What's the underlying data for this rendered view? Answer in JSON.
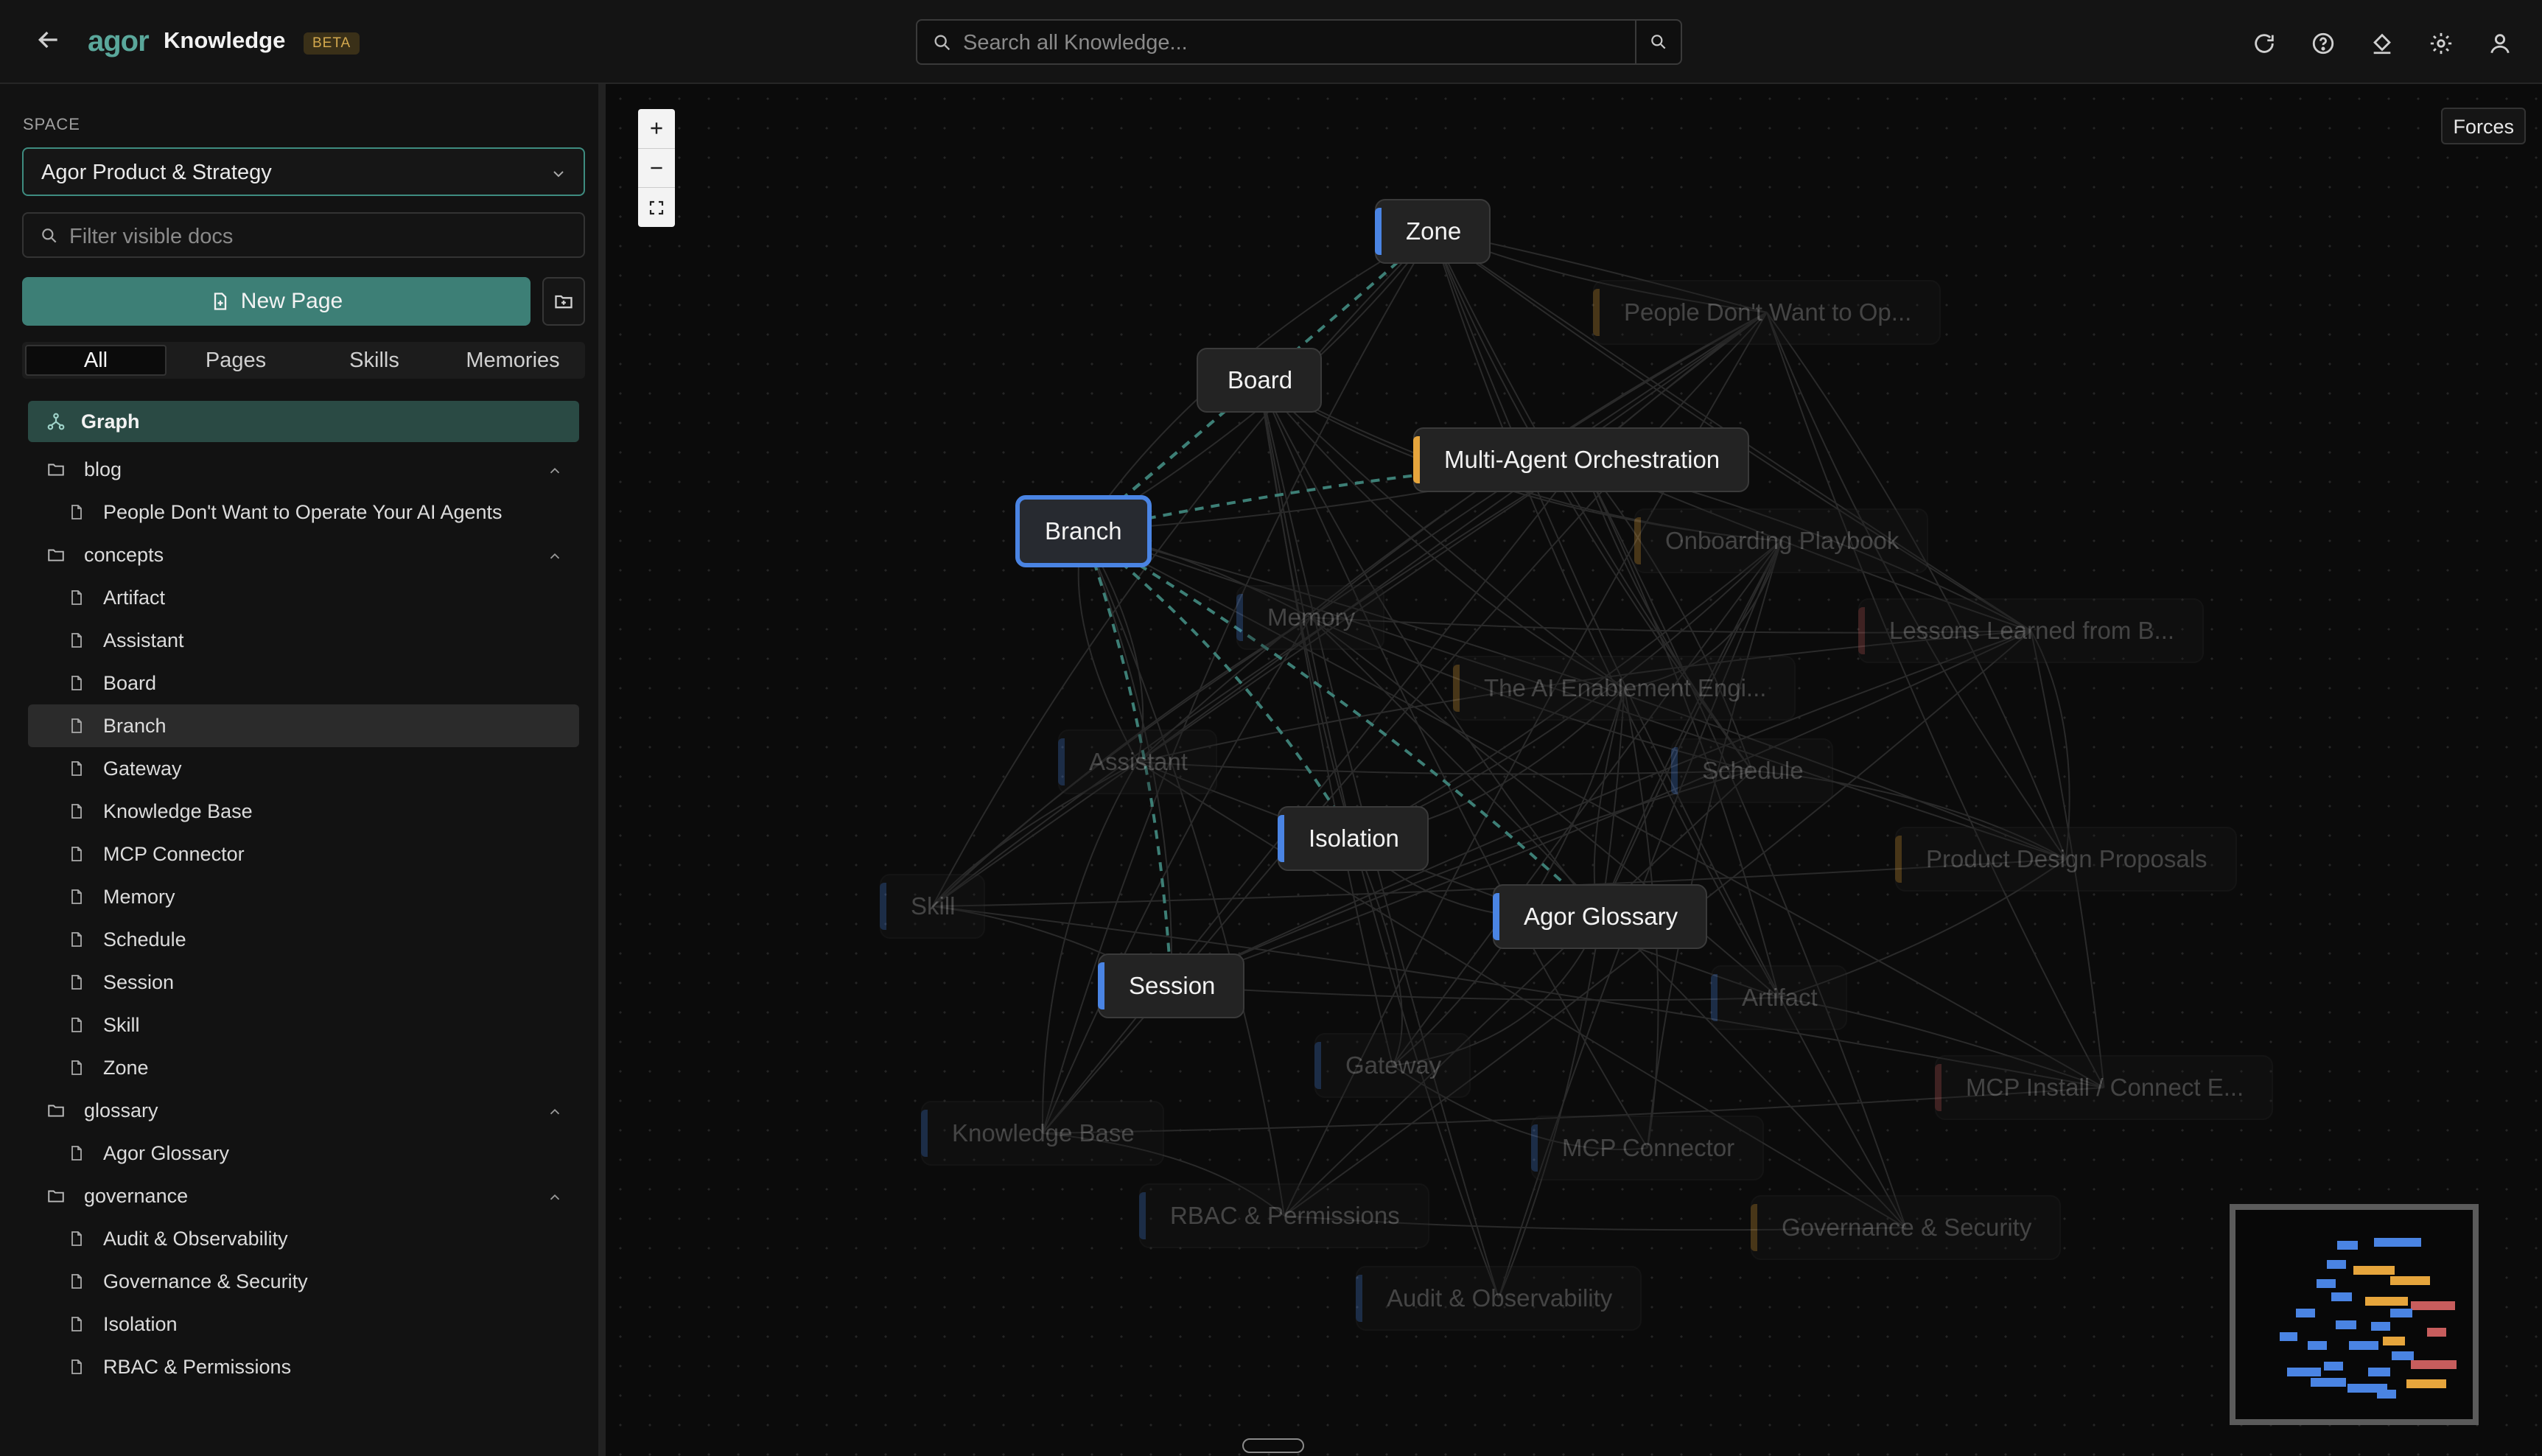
{
  "header": {
    "brand": "agor",
    "title": "Knowledge",
    "badge": "BETA",
    "search_placeholder": "Search all Knowledge...",
    "icons": [
      "back-arrow-icon",
      "search-icon",
      "refresh-icon",
      "help-icon",
      "paint-bucket-icon",
      "gear-icon",
      "user-icon"
    ]
  },
  "sidebar": {
    "space_label": "SPACE",
    "space_value": "Agor Product & Strategy",
    "filter_placeholder": "Filter visible docs",
    "new_page_label": "New Page",
    "tabs": [
      "All",
      "Pages",
      "Skills",
      "Memories"
    ],
    "active_tab": "All",
    "graph_label": "Graph",
    "folders": [
      {
        "name": "blog",
        "items": [
          "People Don't Want to Operate Your AI Agents"
        ]
      },
      {
        "name": "concepts",
        "items": [
          "Artifact",
          "Assistant",
          "Board",
          "Branch",
          "Gateway",
          "Knowledge Base",
          "MCP Connector",
          "Memory",
          "Schedule",
          "Session",
          "Skill",
          "Zone"
        ]
      },
      {
        "name": "glossary",
        "items": [
          "Agor Glossary"
        ]
      },
      {
        "name": "governance",
        "items": [
          "Audit & Observability",
          "Governance & Security",
          "Isolation",
          "RBAC & Permissions"
        ]
      }
    ],
    "selected_item": "Branch"
  },
  "canvas": {
    "forces_label": "Forces",
    "zoom_controls": [
      "plus-icon",
      "minus-icon",
      "fit-screen-icon"
    ],
    "accent_colors": {
      "concept": "#4a84e3",
      "blog": "#e6a53c",
      "governance": "#c75d5d",
      "edge": "#3d7f76"
    },
    "nodes": [
      {
        "label": "Zone",
        "style": "blue",
        "faded": false
      },
      {
        "label": "People Don't Want to Op...",
        "style": "orange",
        "faded": true
      },
      {
        "label": "Board",
        "style": "plain",
        "faded": false
      },
      {
        "label": "Multi-Agent Orchestration",
        "style": "orange",
        "faded": false
      },
      {
        "label": "Branch",
        "style": "branch",
        "faded": false
      },
      {
        "label": "Onboarding Playbook",
        "style": "orange",
        "faded": true
      },
      {
        "label": "Memory",
        "style": "blue",
        "faded": true
      },
      {
        "label": "Lessons Learned from B...",
        "style": "red",
        "faded": true
      },
      {
        "label": "The AI Enablement Engi...",
        "style": "orange",
        "faded": true
      },
      {
        "label": "Assistant",
        "style": "blue",
        "faded": true
      },
      {
        "label": "Schedule",
        "style": "blue",
        "faded": true
      },
      {
        "label": "Isolation",
        "style": "blue",
        "faded": false
      },
      {
        "label": "Product Design Proposals",
        "style": "orange",
        "faded": true
      },
      {
        "label": "Skill",
        "style": "blue",
        "faded": true
      },
      {
        "label": "Agor Glossary",
        "style": "blue",
        "faded": false
      },
      {
        "label": "Session",
        "style": "blue",
        "faded": false
      },
      {
        "label": "Artifact",
        "style": "blue",
        "faded": true
      },
      {
        "label": "Gateway",
        "style": "blue",
        "faded": true
      },
      {
        "label": "MCP Install / Connect E...",
        "style": "red",
        "faded": true
      },
      {
        "label": "Knowledge Base",
        "style": "blue",
        "faded": true
      },
      {
        "label": "MCP Connector",
        "style": "blue",
        "faded": true
      },
      {
        "label": "RBAC & Permissions",
        "style": "blue",
        "faded": true
      },
      {
        "label": "Governance & Security",
        "style": "orange",
        "faded": true
      },
      {
        "label": "Audit & Observability",
        "style": "blue",
        "faded": true
      }
    ]
  }
}
